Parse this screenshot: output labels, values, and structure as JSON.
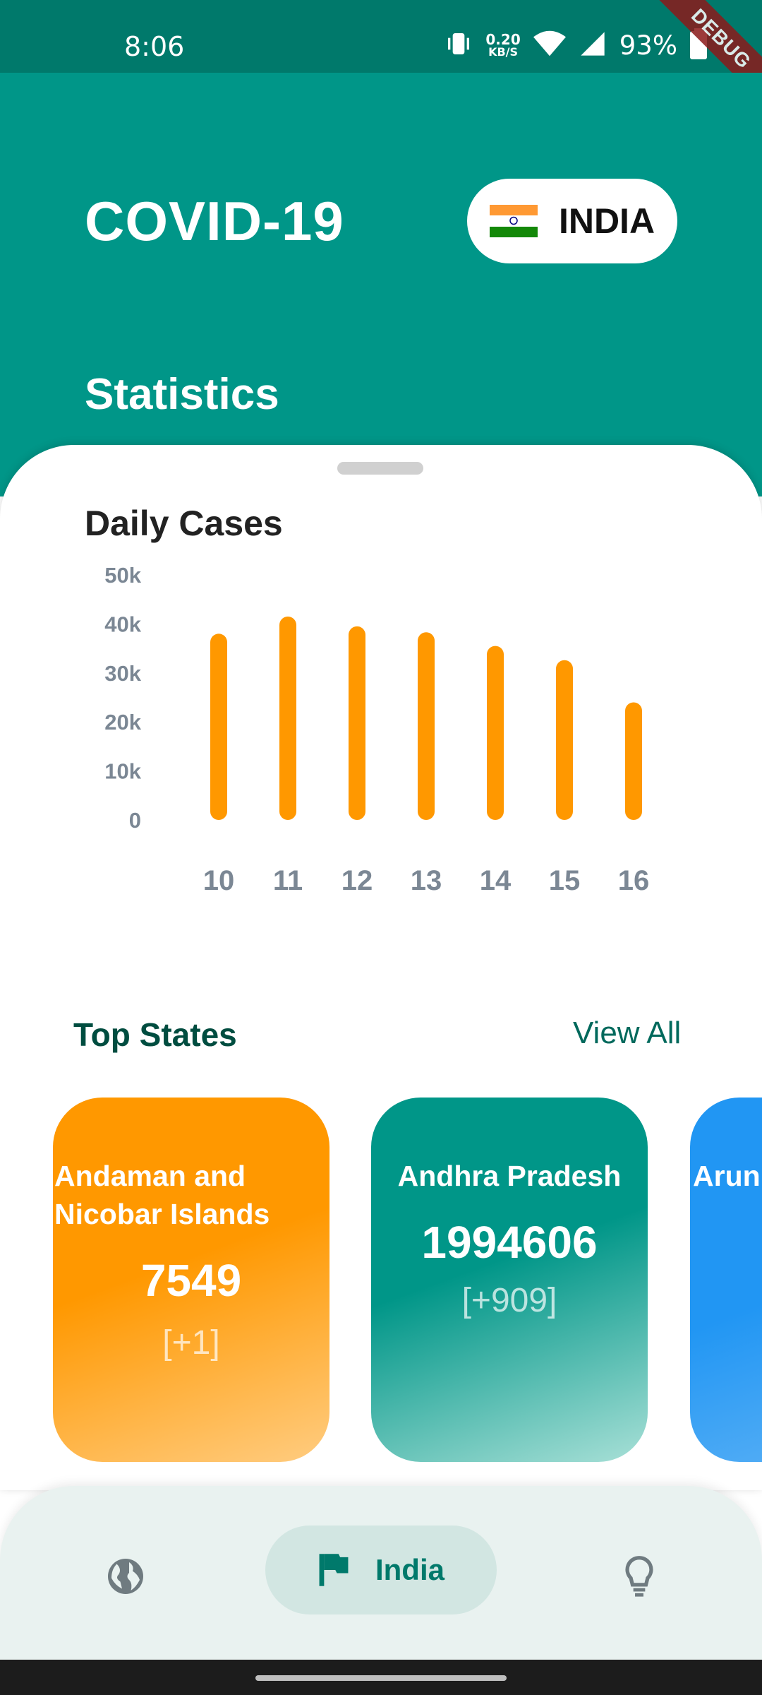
{
  "status_bar": {
    "time": "8:06",
    "net_speed_value": "0.20",
    "net_speed_unit": "KB/S",
    "battery": "93%",
    "debug_label": "DEBUG",
    "icons": [
      "vibrate-icon",
      "wifi-icon",
      "signal-icon",
      "battery-icon"
    ]
  },
  "header": {
    "title": "COVID-19",
    "country": "INDIA",
    "section": "Statistics"
  },
  "colors": {
    "primary": "#009688",
    "primary_dark": "#00796b",
    "bar": "#ff9800",
    "axis_text": "#7b8794"
  },
  "chart_data": {
    "type": "bar",
    "title": "Daily Cases",
    "categories": [
      "10",
      "11",
      "12",
      "13",
      "14",
      "15",
      "16"
    ],
    "values": [
      38000,
      41500,
      39500,
      38300,
      35500,
      32600,
      24000
    ],
    "ylim": [
      0,
      50000
    ],
    "yticks": [
      0,
      10000,
      20000,
      30000,
      40000,
      50000
    ],
    "ytick_labels": [
      "0",
      "10k",
      "20k",
      "30k",
      "40k",
      "50k"
    ],
    "grid": false,
    "legend": "none"
  },
  "top_states": {
    "title": "Top States",
    "view_all": "View All",
    "cards": [
      {
        "name": "Andaman and Nicobar Islands",
        "count": "7549",
        "delta": "[+1]"
      },
      {
        "name": "Andhra Pradesh",
        "count": "1994606",
        "delta": "[+909]"
      },
      {
        "name": "Arun"
      }
    ]
  },
  "bottom_nav": {
    "active_label": "India",
    "items": [
      "globe-icon",
      "flag-icon",
      "lightbulb-icon"
    ]
  }
}
